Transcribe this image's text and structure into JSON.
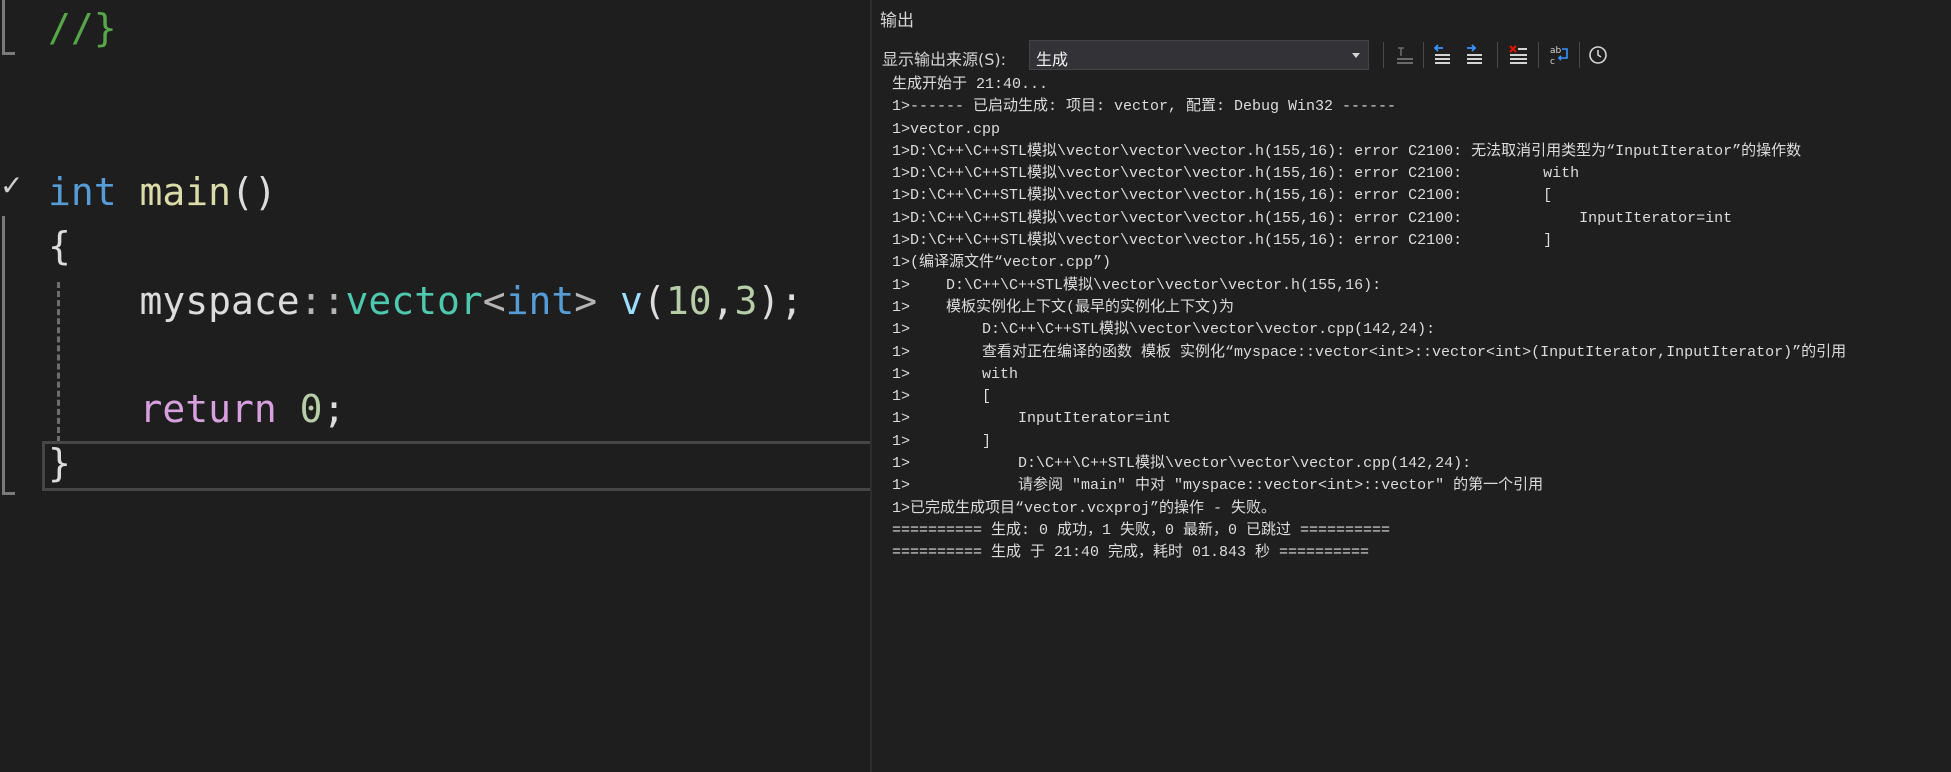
{
  "editor": {
    "lines": [
      [
        {
          "t": "//}",
          "c": "comment"
        }
      ],
      [
        {
          "t": "int",
          "c": "keyword"
        },
        {
          "t": " ",
          "c": "plain"
        },
        {
          "t": "main",
          "c": "func"
        },
        {
          "t": "()",
          "c": "plain"
        }
      ],
      [
        {
          "t": "{",
          "c": "plain"
        }
      ],
      [
        {
          "t": "    myspace",
          "c": "plain"
        },
        {
          "t": "::",
          "c": "punct"
        },
        {
          "t": "vector",
          "c": "type"
        },
        {
          "t": "<",
          "c": "punct"
        },
        {
          "t": "int",
          "c": "keyword"
        },
        {
          "t": ">",
          "c": "punct"
        },
        {
          "t": " ",
          "c": "plain"
        },
        {
          "t": "v",
          "c": "ident"
        },
        {
          "t": "(",
          "c": "plain"
        },
        {
          "t": "10",
          "c": "number"
        },
        {
          "t": ",",
          "c": "plain"
        },
        {
          "t": "3",
          "c": "number"
        },
        {
          "t": ");",
          "c": "plain"
        }
      ],
      [
        {
          "t": "    return",
          "c": "control"
        },
        {
          "t": " ",
          "c": "plain"
        },
        {
          "t": "0",
          "c": "number"
        },
        {
          "t": ";",
          "c": "plain"
        }
      ],
      [
        {
          "t": "}",
          "c": "plain"
        }
      ]
    ]
  },
  "output": {
    "title": "输出",
    "source_label": "显示输出来源(S):",
    "source_value": "生成",
    "toolbar_icons": [
      "goto-line-icon",
      "previous-message-icon",
      "next-message-icon",
      "clear-all-icon",
      "word-wrap-icon",
      "timestamp-clock-icon"
    ],
    "lines": [
      "生成开始于 21:40...",
      "1>------ 已启动生成: 项目: vector, 配置: Debug Win32 ------",
      "1>vector.cpp",
      "1>D:\\C++\\C++STL模拟\\vector\\vector\\vector.h(155,16): error C2100: 无法取消引用类型为“InputIterator”的操作数",
      "1>D:\\C++\\C++STL模拟\\vector\\vector\\vector.h(155,16): error C2100:         with",
      "1>D:\\C++\\C++STL模拟\\vector\\vector\\vector.h(155,16): error C2100:         [",
      "1>D:\\C++\\C++STL模拟\\vector\\vector\\vector.h(155,16): error C2100:             InputIterator=int",
      "1>D:\\C++\\C++STL模拟\\vector\\vector\\vector.h(155,16): error C2100:         ]",
      "1>(编译源文件“vector.cpp”)",
      "1>    D:\\C++\\C++STL模拟\\vector\\vector\\vector.h(155,16):",
      "1>    模板实例化上下文(最早的实例化上下文)为",
      "1>        D:\\C++\\C++STL模拟\\vector\\vector\\vector.cpp(142,24):",
      "1>        查看对正在编译的函数 模板 实例化“myspace::vector<int>::vector<int>(InputIterator,InputIterator)”的引用",
      "1>        with",
      "1>        [",
      "1>            InputIterator=int",
      "1>        ]",
      "1>            D:\\C++\\C++STL模拟\\vector\\vector\\vector.cpp(142,24):",
      "1>            请参阅 \"main\" 中对 \"myspace::vector<int>::vector\" 的第一个引用",
      "1>已完成生成项目“vector.vcxproj”的操作 - 失败。",
      "========== 生成: 0 成功，1 失败，0 最新，0 已跳过 ==========",
      "========== 生成 于 21:40 完成，耗时 01.843 秒 =========="
    ]
  }
}
